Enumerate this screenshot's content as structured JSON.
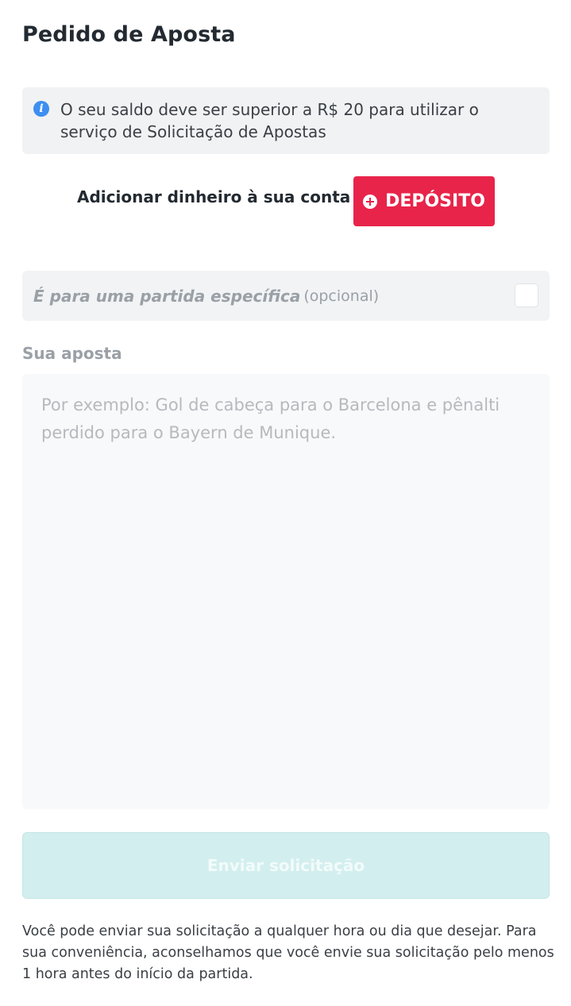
{
  "header": {
    "title": "Pedido de Aposta"
  },
  "info": {
    "icon": "info-icon",
    "icon_glyph": "i",
    "text": "O seu saldo deve ser superior a R$ 20 para utilizar o serviço de Solicitação de Apostas"
  },
  "deposit": {
    "label": "Adicionar dinheiro à sua conta",
    "button_label": "DEPÓSITO",
    "button_color": "#e8244a"
  },
  "match": {
    "label": "É para uma partida específica",
    "optional": "(opcional)",
    "checked": false
  },
  "bet": {
    "label": "Sua aposta",
    "value": "",
    "placeholder": "Por exemplo: Gol de cabeça para o Barcelona e pênalti perdido para o Bayern de Munique."
  },
  "submit": {
    "label": "Enviar solicitação",
    "disabled": true
  },
  "footer": {
    "note": "Você pode enviar sua solicitação a qualquer hora ou dia que desejar. Para sua conveniência, aconselhamos que você envie sua solicitação pelo menos 1 hora antes do início da partida."
  }
}
